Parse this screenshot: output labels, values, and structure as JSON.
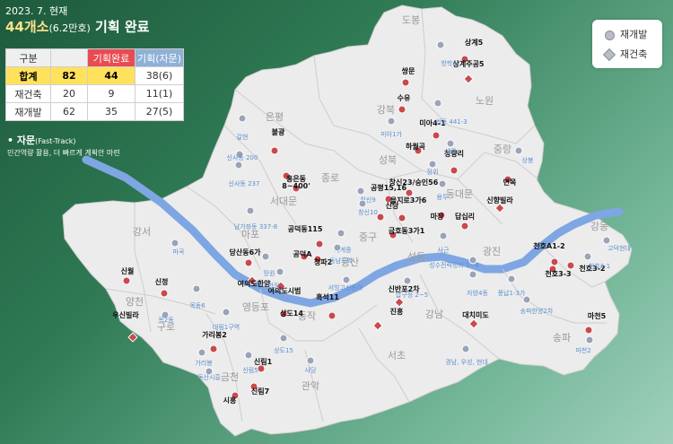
{
  "header": {
    "date": "2023. 7. 현재",
    "title_count": "44개소",
    "title_sub": "(6.2만호)",
    "title_text": "기획 완료"
  },
  "stats": {
    "headers": [
      "구분",
      "",
      "기획완료",
      "기획(자문)"
    ],
    "rows": [
      {
        "label": "합계",
        "total": "82",
        "done": "44",
        "advisory": "38(6)"
      },
      {
        "label": "재건축",
        "total": "20",
        "done": "9",
        "advisory": "11(1)"
      },
      {
        "label": "재개발",
        "total": "62",
        "done": "35",
        "advisory": "27(5)"
      }
    ]
  },
  "note": {
    "title": "자문",
    "title_sub": "(Fast-Track)",
    "desc": "민간역량 활용, 더 빠르게 계획안 마련"
  },
  "legend": {
    "redevelopment": "재개발",
    "reconstruction": "재건축"
  },
  "colors": {
    "done": "#c84a4e",
    "advisory": "#9aa3b8",
    "map_fill": "#ececec",
    "river": "#7ea6e2",
    "district_label": "#999999",
    "advisory_label": "#5a8fd0"
  },
  "districts": [
    "도봉",
    "강북",
    "노원",
    "은평",
    "성북",
    "중랑",
    "종로",
    "서대문",
    "동대문",
    "마포",
    "중구",
    "성동",
    "광진",
    "강동",
    "강서",
    "양천",
    "용산",
    "송파",
    "영등포",
    "구로",
    "동작",
    "강남",
    "서초",
    "금천",
    "관악"
  ],
  "sites_done": [
    {
      "name": "상계5",
      "type": "dot"
    },
    {
      "name": "상계주공5",
      "type": "diamond"
    },
    {
      "name": "쌍문",
      "type": "dot"
    },
    {
      "name": "수유",
      "type": "dot"
    },
    {
      "name": "미아4-1",
      "type": "dot"
    },
    {
      "name": "하월곡",
      "type": "dot"
    },
    {
      "name": "청량리",
      "type": "dot"
    },
    {
      "name": "면목",
      "type": "dot"
    },
    {
      "name": "불광",
      "type": "dot"
    },
    {
      "name": "홍은동",
      "type": "dot"
    },
    {
      "name": "8~400'",
      "type": "dot"
    },
    {
      "name": "창신23/숭인56",
      "type": "dot"
    },
    {
      "name": "공평15,16",
      "type": "dot"
    },
    {
      "name": "을지로3가6",
      "type": "dot"
    },
    {
      "name": "신당",
      "type": "dot"
    },
    {
      "name": "마장",
      "type": "dot"
    },
    {
      "name": "답십리",
      "type": "dot"
    },
    {
      "name": "신향빌라",
      "type": "diamond"
    },
    {
      "name": "금호동3가1",
      "type": "dot"
    },
    {
      "name": "공덕동115",
      "type": "dot"
    },
    {
      "name": "공덕A",
      "type": "dot"
    },
    {
      "name": "청파2",
      "type": "dot"
    },
    {
      "name": "당산동6가",
      "type": "dot"
    },
    {
      "name": "여의도한양",
      "type": "diamond"
    },
    {
      "name": "여의도시범",
      "type": "diamond"
    },
    {
      "name": "신월",
      "type": "dot"
    },
    {
      "name": "신정",
      "type": "dot"
    },
    {
      "name": "우신빌라",
      "type": "diamond"
    },
    {
      "name": "신반포2차",
      "type": "diamond"
    },
    {
      "name": "흑석11",
      "type": "dot"
    },
    {
      "name": "진흥",
      "type": "diamond"
    },
    {
      "name": "대치미도",
      "type": "diamond"
    },
    {
      "name": "상도14",
      "type": "dot"
    },
    {
      "name": "가리봉2",
      "type": "dot"
    },
    {
      "name": "신림1",
      "type": "dot"
    },
    {
      "name": "신림7",
      "type": "dot"
    },
    {
      "name": "시흥",
      "type": "dot"
    },
    {
      "name": "천호A1-2",
      "type": "dot"
    },
    {
      "name": "천호3-3",
      "type": "dot"
    },
    {
      "name": "천호3-2",
      "type": "dot"
    },
    {
      "name": "마천5",
      "type": "dot"
    }
  ],
  "sites_advisory": [
    {
      "name": "방학3"
    },
    {
      "name": "번동 441-3"
    },
    {
      "name": "미아1가"
    },
    {
      "name": "석관"
    },
    {
      "name": "장위"
    },
    {
      "name": "용두"
    },
    {
      "name": "상봉"
    },
    {
      "name": "고덕현대"
    },
    {
      "name": "천호3-1"
    },
    {
      "name": "갈현"
    },
    {
      "name": "신사동 200"
    },
    {
      "name": "신사동 237"
    },
    {
      "name": "창신9"
    },
    {
      "name": "창신10"
    },
    {
      "name": "세계중"
    },
    {
      "name": "동남구역"
    },
    {
      "name": "남가좌동 337-8"
    },
    {
      "name": "망원"
    },
    {
      "name": "마곡"
    },
    {
      "name": "합정"
    },
    {
      "name": "목동6"
    },
    {
      "name": "목2동"
    },
    {
      "name": "대림1구역"
    },
    {
      "name": "사근"
    },
    {
      "name": "성수전략정비 1~4"
    },
    {
      "name": "서빙고신동아"
    },
    {
      "name": "압구정 2~5"
    },
    {
      "name": "자양4동"
    },
    {
      "name": "풍납1-3가"
    },
    {
      "name": "송파한양2차"
    },
    {
      "name": "가리봉"
    },
    {
      "name": "독산시흥"
    },
    {
      "name": "신림5"
    },
    {
      "name": "상도15"
    },
    {
      "name": "사당"
    },
    {
      "name": "경남, 우성, 현대"
    },
    {
      "name": "마천2"
    }
  ]
}
